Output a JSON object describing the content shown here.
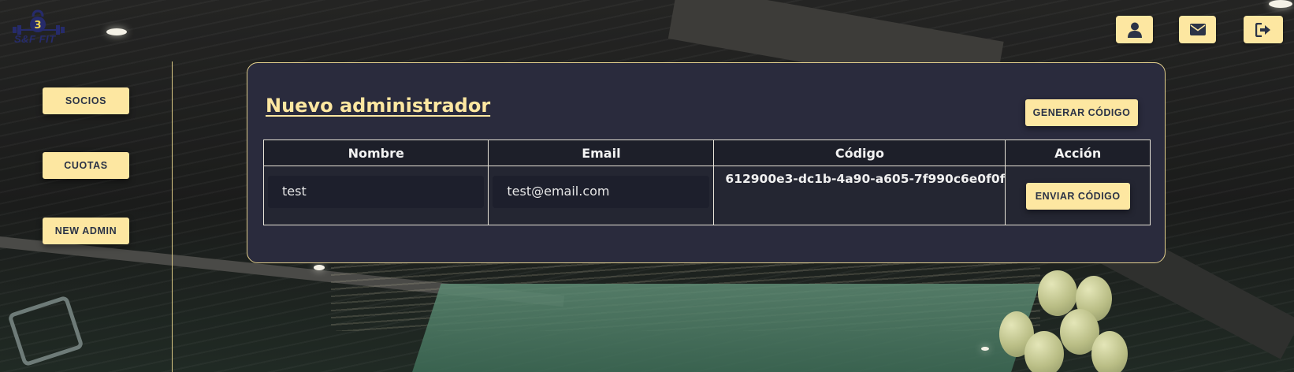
{
  "app": {
    "logo_text": "S&F FIT"
  },
  "header": {
    "icons": [
      {
        "name": "user-icon"
      },
      {
        "name": "mail-icon"
      },
      {
        "name": "logout-icon"
      }
    ]
  },
  "sidebar": {
    "items": [
      {
        "label": "SOCIOS"
      },
      {
        "label": "CUOTAS"
      },
      {
        "label": "NEW ADMIN"
      }
    ]
  },
  "main": {
    "title": "Nuevo administrador",
    "generate_button": "GENERAR CÓDIGO",
    "table": {
      "columns": [
        "Nombre",
        "Email",
        "Código",
        "Acción"
      ],
      "rows": [
        {
          "nombre": "test",
          "email": "test@email.com",
          "codigo": "612900e3-dc1b-4a90-a605-7f990c6e0f0f",
          "action": "ENVIAR CÓDIGO"
        }
      ]
    }
  },
  "colors": {
    "accent": "#fde7a1",
    "card_bg": "#2a2b3d",
    "card_border": "#e2cf8c",
    "button_text": "#2b3346"
  }
}
